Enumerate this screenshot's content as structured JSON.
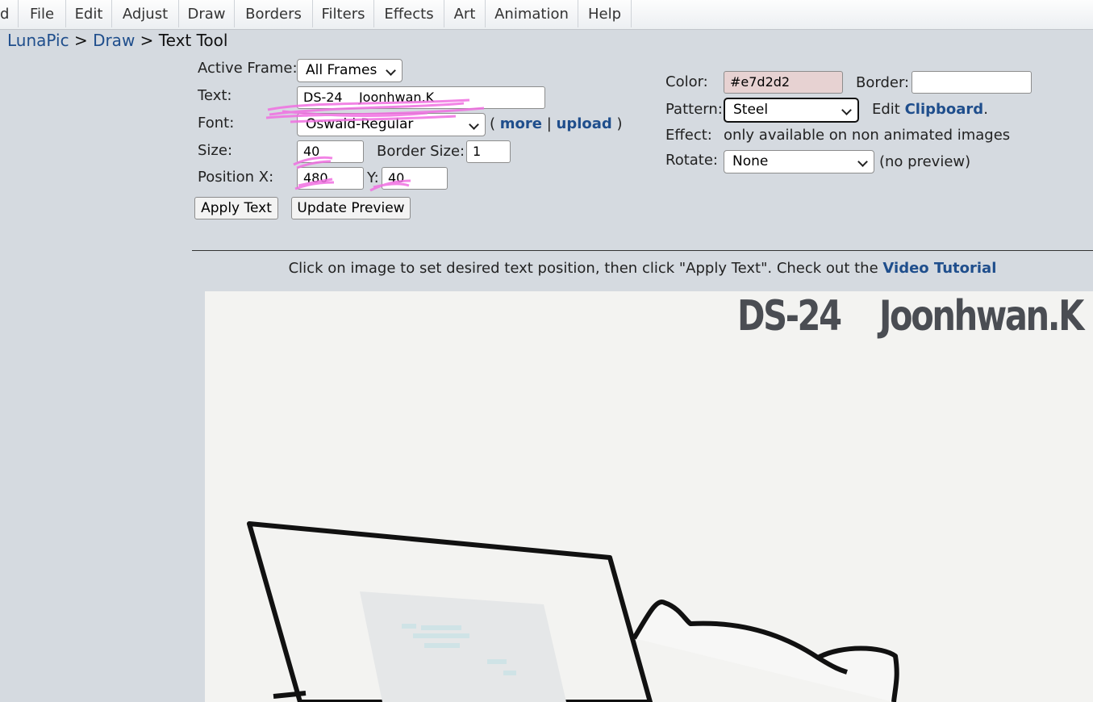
{
  "menu": {
    "items": [
      "d",
      "File",
      "Edit",
      "Adjust",
      "Draw",
      "Borders",
      "Filters",
      "Effects",
      "Art",
      "Animation",
      "Help"
    ]
  },
  "breadcrumb": {
    "home": "LunaPic",
    "sep1": ">",
    "section": "Draw",
    "sep2": ">",
    "current": "Text Tool"
  },
  "form": {
    "active_frame_label": "Active Frame:",
    "active_frame_value": "All Frames",
    "text_label": "Text:",
    "text_value": "DS-24    Joonhwan.K",
    "font_label": "Font:",
    "font_value": "Oswald-Regular",
    "font_more_open": "(",
    "font_more": "more",
    "font_sep": "|",
    "font_upload": "upload",
    "font_more_close": ")",
    "size_label": "Size:",
    "size_value": "40",
    "border_size_label": "Border Size:",
    "border_size_value": "1",
    "position_x_label": "Position X:",
    "position_x_value": "480",
    "position_y_label": "Y:",
    "position_y_value": "40",
    "apply_button": "Apply Text",
    "preview_button": "Update Preview"
  },
  "style_panel": {
    "color_label": "Color:",
    "color_value": "#e7d2d2",
    "color_swatch": "#e7d2d2",
    "border_label": "Border:",
    "border_value": "",
    "pattern_label": "Pattern:",
    "pattern_value": "Steel",
    "edit_prefix": "Edit",
    "clipboard_link": "Clipboard",
    "edit_suffix": ".",
    "effect_label": "Effect:",
    "effect_value": "only available on non animated images",
    "rotate_label": "Rotate:",
    "rotate_value": "None",
    "rotate_note": "(no preview)"
  },
  "instructions": {
    "text": "Click on image to set desired text position, then click \"Apply Text\". Check out the",
    "link": "Video Tutorial"
  },
  "canvas": {
    "overlay_text": "DS-24    Joonhwan.K"
  },
  "colors": {
    "background": "#d5dae0",
    "link": "#1f4e8c",
    "scribble": "#f06ee0"
  }
}
